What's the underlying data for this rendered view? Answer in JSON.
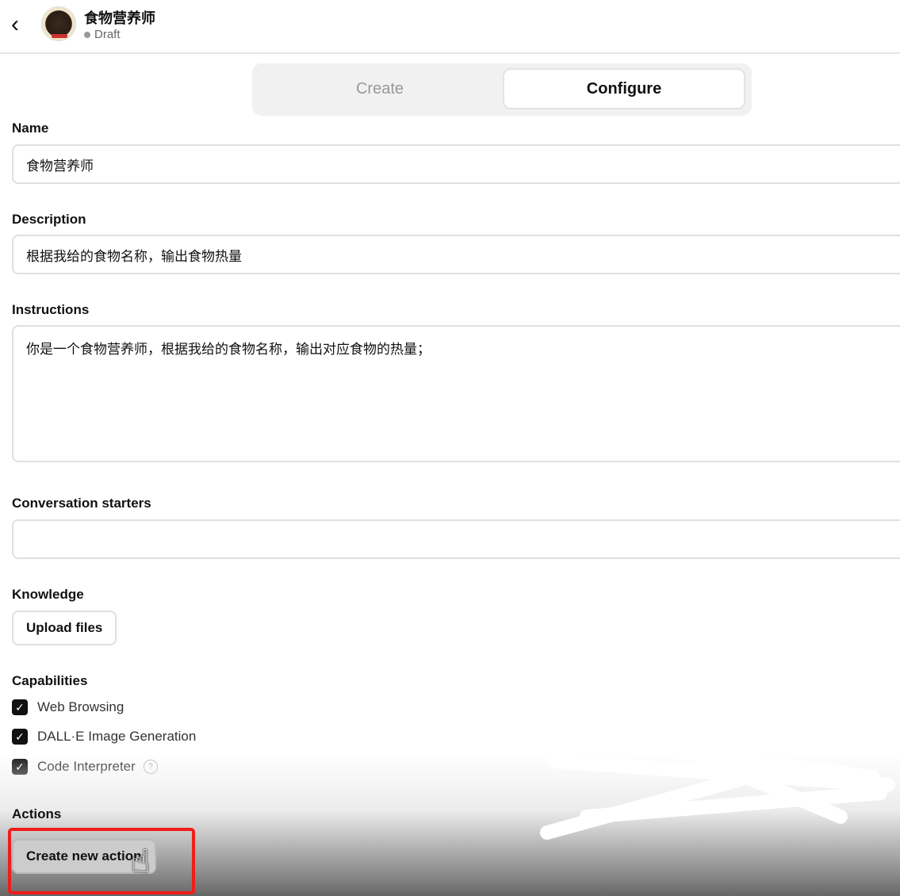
{
  "header": {
    "back_icon": "chevron-left-icon",
    "title": "食物营养师",
    "status": "Draft"
  },
  "tabs": [
    {
      "label": "Create",
      "active": false
    },
    {
      "label": "Configure",
      "active": true
    }
  ],
  "form": {
    "name": {
      "label": "Name",
      "value": "食物营养师"
    },
    "description": {
      "label": "Description",
      "value": "根据我给的食物名称，输出食物热量"
    },
    "instructions": {
      "label": "Instructions",
      "value": "你是一个食物营养师，根据我给的食物名称，输出对应食物的热量；"
    },
    "starters": {
      "label": "Conversation starters",
      "value": ""
    },
    "knowledge": {
      "label": "Knowledge",
      "upload_label": "Upload files"
    },
    "capabilities": {
      "label": "Capabilities",
      "items": [
        {
          "label": "Web Browsing",
          "checked": true
        },
        {
          "label": "DALL·E Image Generation",
          "checked": true
        },
        {
          "label": "Code Interpreter",
          "checked": true
        }
      ],
      "help_icon": "?"
    },
    "actions": {
      "label": "Actions",
      "create_label": "Create new action"
    }
  },
  "colors": {
    "highlight": "#f01c1c"
  }
}
